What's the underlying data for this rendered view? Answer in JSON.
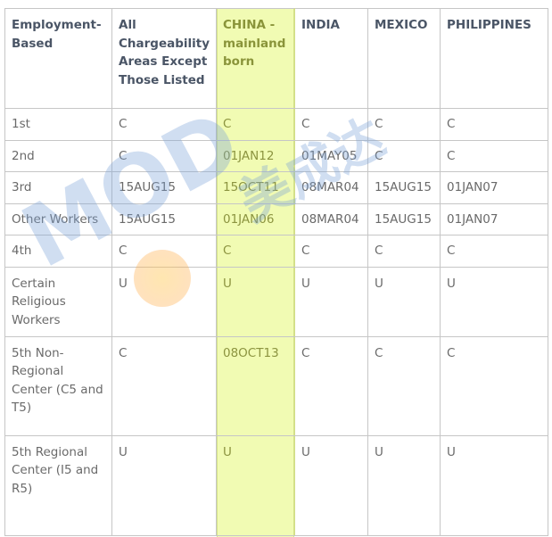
{
  "table": {
    "headers": [
      "Employment-Based",
      "All Chargeability Areas Except Those Listed",
      "CHINA - mainland born",
      "INDIA",
      "MEXICO",
      "PHILIPPINES"
    ],
    "rows": [
      {
        "category": "1st",
        "values": [
          "C",
          "C",
          "C",
          "C",
          "C"
        ]
      },
      {
        "category": "2nd",
        "values": [
          "C",
          "01JAN12",
          "01MAY05",
          "C",
          "C"
        ]
      },
      {
        "category": "3rd",
        "values": [
          "15AUG15",
          "15OCT11",
          "08MAR04",
          "15AUG15",
          "01JAN07"
        ]
      },
      {
        "category": "Other Workers",
        "values": [
          "15AUG15",
          "01JAN06",
          "08MAR04",
          "15AUG15",
          "01JAN07"
        ]
      },
      {
        "category": "4th",
        "values": [
          "C",
          "C",
          "C",
          "C",
          "C"
        ]
      },
      {
        "category": "Certain Religious Workers",
        "values": [
          "U",
          "U",
          "U",
          "U",
          "U"
        ]
      },
      {
        "category": "5th Non-Regional Center (C5 and T5)",
        "values": [
          "C",
          "08OCT13",
          "C",
          "C",
          "C"
        ]
      },
      {
        "category": "5th Regional Center (I5 and R5)",
        "values": [
          "U",
          "U",
          "U",
          "U",
          "U"
        ]
      }
    ],
    "highlight_column": "CHINA - mainland born",
    "highlight_color": "#f1fbb3"
  },
  "watermark": {
    "text": "MOD",
    "chinese_text": "美成达",
    "icon": "compass-icon"
  }
}
